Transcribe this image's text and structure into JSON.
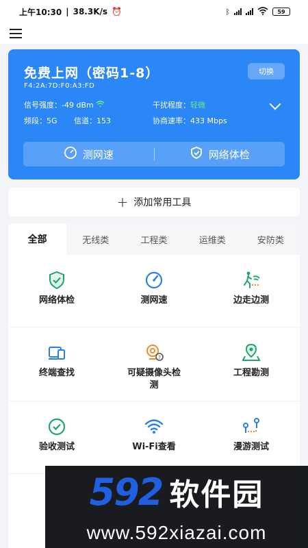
{
  "status_bar": {
    "time": "上午10:30",
    "speed": "38.3K/s",
    "battery": "59"
  },
  "wifi": {
    "ssid": "免费上网（密码1-8）",
    "mac": "F4:2A:7D:F0:A3:FD",
    "switch_label": "切换",
    "signal_label": "信号强度：",
    "signal_value": "-49 dBm",
    "interference_label": "干扰程度：",
    "interference_value": "轻微",
    "band_label": "频段：",
    "band_value": "5G",
    "channel_label": "信道：",
    "channel_value": "153",
    "rate_label": "协商速率：",
    "rate_value": "433 Mbps",
    "actions": {
      "speed_test": "测网速",
      "network_check": "网络体检"
    }
  },
  "add_tools_label": "添加常用工具",
  "tabs": [
    "全部",
    "无线类",
    "工程类",
    "运维类",
    "安防类"
  ],
  "tools": [
    {
      "label": "网络体检",
      "icon": "shield-check-icon"
    },
    {
      "label": "测网速",
      "icon": "speedometer-icon"
    },
    {
      "label": "边走边测",
      "icon": "walking-wifi-icon"
    },
    {
      "label": "终端查找",
      "icon": "devices-icon"
    },
    {
      "label": "可疑摄像头检测",
      "icon": "camera-question-icon"
    },
    {
      "label": "工程勘测",
      "icon": "map-pin-icon"
    },
    {
      "label": "验收测试",
      "icon": "check-circle-icon"
    },
    {
      "label": "Wi-Fi查看",
      "icon": "wifi-icon"
    },
    {
      "label": "漫游测试",
      "icon": "roaming-icon"
    }
  ],
  "watermark": {
    "number": "592",
    "name": "软件园",
    "url": "www.592xiazai.com"
  },
  "colors": {
    "accent": "#2b86f6",
    "icon_green": "#1fa56b",
    "icon_blue": "#2b7de9",
    "icon_orange": "#f08a2c"
  }
}
